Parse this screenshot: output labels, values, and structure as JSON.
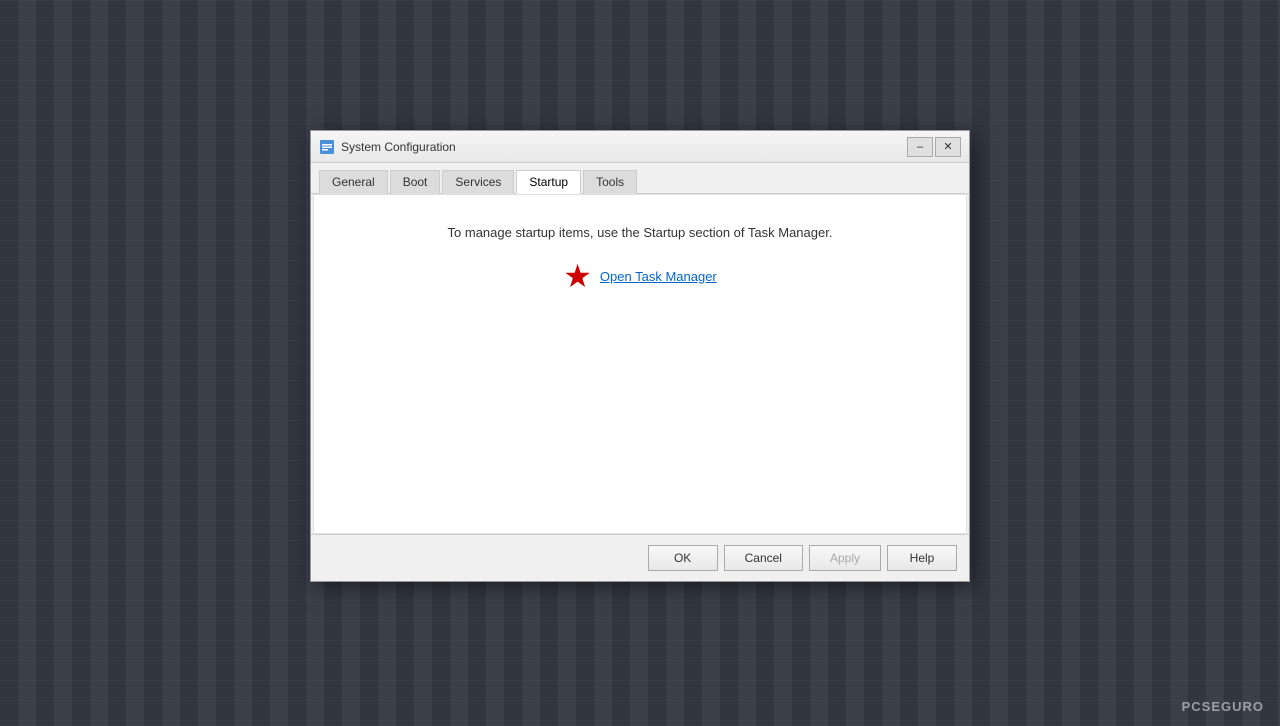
{
  "background": {
    "watermark": "PCSEGURO"
  },
  "dialog": {
    "title": "System Configuration",
    "icon": "gear-icon",
    "tabs": [
      {
        "label": "General",
        "active": false
      },
      {
        "label": "Boot",
        "active": false
      },
      {
        "label": "Services",
        "active": false
      },
      {
        "label": "Startup",
        "active": true
      },
      {
        "label": "Tools",
        "active": false
      }
    ],
    "content": {
      "description": "To manage startup items, use the Startup section of Task Manager.",
      "link_text": "Open Task Manager"
    },
    "buttons": {
      "ok": "OK",
      "cancel": "Cancel",
      "apply": "Apply",
      "help": "Help"
    }
  }
}
